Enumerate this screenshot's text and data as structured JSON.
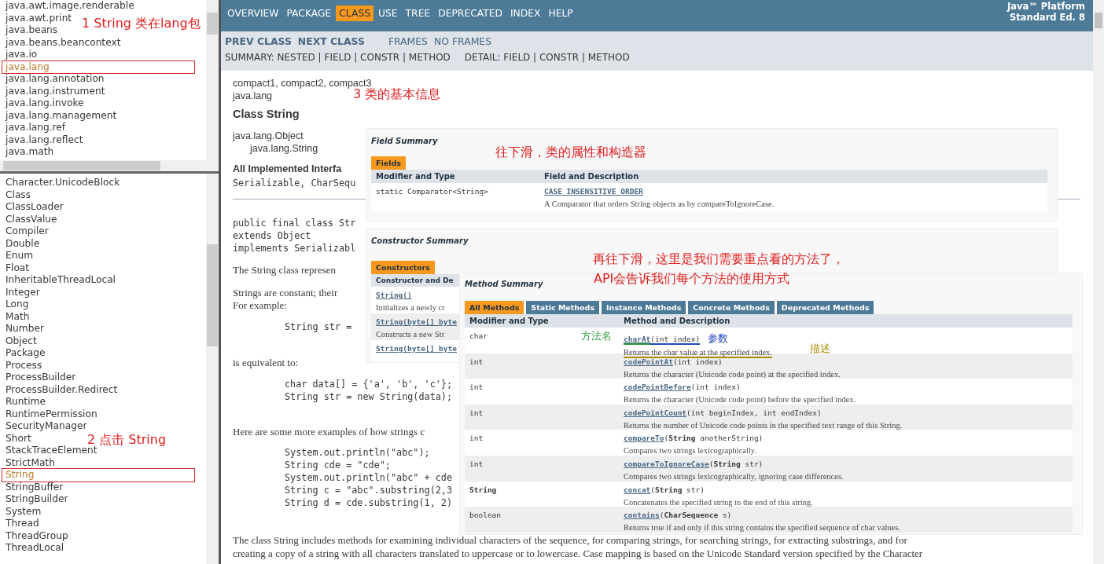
{
  "package_frame": {
    "items": [
      {
        "label": "java.awt.image.renderable",
        "highlighted": false
      },
      {
        "label": "java.awt.print",
        "highlighted": false
      },
      {
        "label": "java.beans",
        "highlighted": false
      },
      {
        "label": "java.beans.beancontext",
        "highlighted": false
      },
      {
        "label": "java.io",
        "highlighted": false
      },
      {
        "label": "java.lang",
        "highlighted": true
      },
      {
        "label": "java.lang.annotation",
        "highlighted": false
      },
      {
        "label": "java.lang.instrument",
        "highlighted": false
      },
      {
        "label": "java.lang.invoke",
        "highlighted": false
      },
      {
        "label": "java.lang.management",
        "highlighted": false
      },
      {
        "label": "java.lang.ref",
        "highlighted": false
      },
      {
        "label": "java.lang.reflect",
        "highlighted": false
      },
      {
        "label": "java.math",
        "highlighted": false
      }
    ],
    "annotation": "1 String 类在lang包"
  },
  "class_frame": {
    "items": [
      {
        "label": "Character.UnicodeBlock",
        "highlighted": false
      },
      {
        "label": "Class",
        "highlighted": false
      },
      {
        "label": "ClassLoader",
        "highlighted": false
      },
      {
        "label": "ClassValue",
        "highlighted": false
      },
      {
        "label": "Compiler",
        "highlighted": false
      },
      {
        "label": "Double",
        "highlighted": false
      },
      {
        "label": "Enum",
        "highlighted": false
      },
      {
        "label": "Float",
        "highlighted": false
      },
      {
        "label": "InheritableThreadLocal",
        "highlighted": false
      },
      {
        "label": "Integer",
        "highlighted": false
      },
      {
        "label": "Long",
        "highlighted": false
      },
      {
        "label": "Math",
        "highlighted": false
      },
      {
        "label": "Number",
        "highlighted": false
      },
      {
        "label": "Object",
        "highlighted": false
      },
      {
        "label": "Package",
        "highlighted": false
      },
      {
        "label": "Process",
        "highlighted": false
      },
      {
        "label": "ProcessBuilder",
        "highlighted": false
      },
      {
        "label": "ProcessBuilder.Redirect",
        "highlighted": false
      },
      {
        "label": "Runtime",
        "highlighted": false
      },
      {
        "label": "RuntimePermission",
        "highlighted": false
      },
      {
        "label": "SecurityManager",
        "highlighted": false
      },
      {
        "label": "Short",
        "highlighted": false
      },
      {
        "label": "StackTraceElement",
        "highlighted": false
      },
      {
        "label": "StrictMath",
        "highlighted": false
      },
      {
        "label": "String",
        "highlighted": true
      },
      {
        "label": "StringBuffer",
        "highlighted": false
      },
      {
        "label": "StringBuilder",
        "highlighted": false
      },
      {
        "label": "System",
        "highlighted": false
      },
      {
        "label": "Thread",
        "highlighted": false
      },
      {
        "label": "ThreadGroup",
        "highlighted": false
      },
      {
        "label": "ThreadLocal",
        "highlighted": false
      }
    ],
    "annotation": "2 点击 String"
  },
  "nav": {
    "items": [
      {
        "label": "OVERVIEW",
        "selected": false
      },
      {
        "label": "PACKAGE",
        "selected": false
      },
      {
        "label": "CLASS",
        "selected": true
      },
      {
        "label": "USE",
        "selected": false
      },
      {
        "label": "TREE",
        "selected": false
      },
      {
        "label": "DEPRECATED",
        "selected": false
      },
      {
        "label": "INDEX",
        "selected": false
      },
      {
        "label": "HELP",
        "selected": false
      }
    ],
    "platform": [
      "Java™ Platform",
      "Standard Ed. 8"
    ]
  },
  "subnav": {
    "class_links": [
      "PREV CLASS",
      "NEXT CLASS"
    ],
    "frame_links": [
      "FRAMES",
      "NO FRAMES"
    ],
    "summary": "SUMMARY: NESTED | FIELD | CONSTR | METHOD",
    "detail": "DETAIL: FIELD | CONSTR | METHOD"
  },
  "content": {
    "profiles": "compact1, compact2, compact3",
    "package": "java.lang",
    "title": "Class String",
    "annotation": "3 类的基本信息",
    "hierarchy": [
      "java.lang.Object",
      "java.lang.String"
    ],
    "interfaces_heading": "All Implemented Interfa",
    "interfaces": "Serializable, CharSequ",
    "declaration": [
      "public final class Str",
      "extends Object",
      "implements Serializabl"
    ],
    "intro": "The String class represen",
    "constant_lines": [
      "Strings are constant; their",
      "For example:"
    ],
    "example_1": [
      "String str ="
    ],
    "equivalent": "is equivalent to:",
    "example_2": [
      "char data[] = {'a', 'b', 'c'};",
      "String str = new String(data);"
    ],
    "more": "Here are some more examples of how strings c",
    "example_3": [
      "System.out.println(\"abc\");",
      "String cde = \"cde\";",
      "System.out.println(\"abc\" + cde",
      "String c = \"abc\".substring(2,3",
      "String d = cde.substring(1, 2)"
    ],
    "closing": [
      "The class String includes methods for examining individual characters of the sequence, for comparing strings, for searching strings, for extracting substrings, and for",
      "creating a copy of a string with all characters translated to uppercase or to lowercase. Case mapping is based on the Unicode Standard version specified by the Character"
    ]
  },
  "field_summary": {
    "title": "Field Summary",
    "tab": "Fields",
    "columns": [
      "Modifier and Type",
      "Field and Description"
    ],
    "rows": [
      {
        "modifier": "static Comparator<String>",
        "name": "CASE_INSENSITIVE_ORDER",
        "description": "A Comparator that orders String objects as by compareToIgnoreCase."
      }
    ],
    "annotation": "往下滑，类的属性和构造器"
  },
  "constructor_summary": {
    "title": "Constructor Summary",
    "tab": "Constructors",
    "column": "Constructor and De",
    "rows": [
      {
        "signature": "String()",
        "description": "Initializes a newly cr"
      },
      {
        "signature": "String(byte[] byte",
        "description": "Constructs a new Str"
      },
      {
        "signature": "String(byte[] byte"
      }
    ]
  },
  "method_summary": {
    "annotation": [
      "再往下滑，这里是我们需要重点看的方法了，",
      "API会告诉我们每个方法的使用方式"
    ],
    "title": "Method Summary",
    "tabs": [
      {
        "label": "All Methods",
        "selected": true
      },
      {
        "label": "Static Methods",
        "selected": false
      },
      {
        "label": "Instance Methods",
        "selected": false
      },
      {
        "label": "Concrete Methods",
        "selected": false
      },
      {
        "label": "Deprecated Methods",
        "selected": false
      }
    ],
    "columns": [
      "Modifier and Type",
      "Method and Description"
    ],
    "rows": [
      {
        "type": "char",
        "name": "charAt",
        "params": "(int index)",
        "description": "Returns the char value at the specified index.",
        "name_note": "方法名",
        "params_note": "参数",
        "description_note": "描述"
      },
      {
        "type": "int",
        "name": "codePointAt",
        "params": "(int index)",
        "description": "Returns the character (Unicode code point) at the specified index."
      },
      {
        "type": "int",
        "name": "codePointBefore",
        "params": "(int index)",
        "description": "Returns the character (Unicode code point) before the specified index."
      },
      {
        "type": "int",
        "name": "codePointCount",
        "params": "(int beginIndex, int endIndex)",
        "description": "Returns the number of Unicode code points in the specified text range of this String."
      },
      {
        "type": "int",
        "name": "compareTo",
        "params": "(**String** anotherString)",
        "description": "Compares two strings lexicographically."
      },
      {
        "type": "int",
        "name": "compareToIgnoreCase",
        "params": "(**String** str)",
        "description": "Compares two strings lexicographically, ignoring case differences."
      },
      {
        "type": "**String**",
        "name": "concat",
        "params": "(**String** str)",
        "description": "Concatenates the specified string to the end of this string."
      },
      {
        "type": "boolean",
        "name": "contains",
        "params": "(**CharSequence** s)",
        "description": "Returns true if and only if this string contains the specified sequence of char values."
      }
    ]
  }
}
